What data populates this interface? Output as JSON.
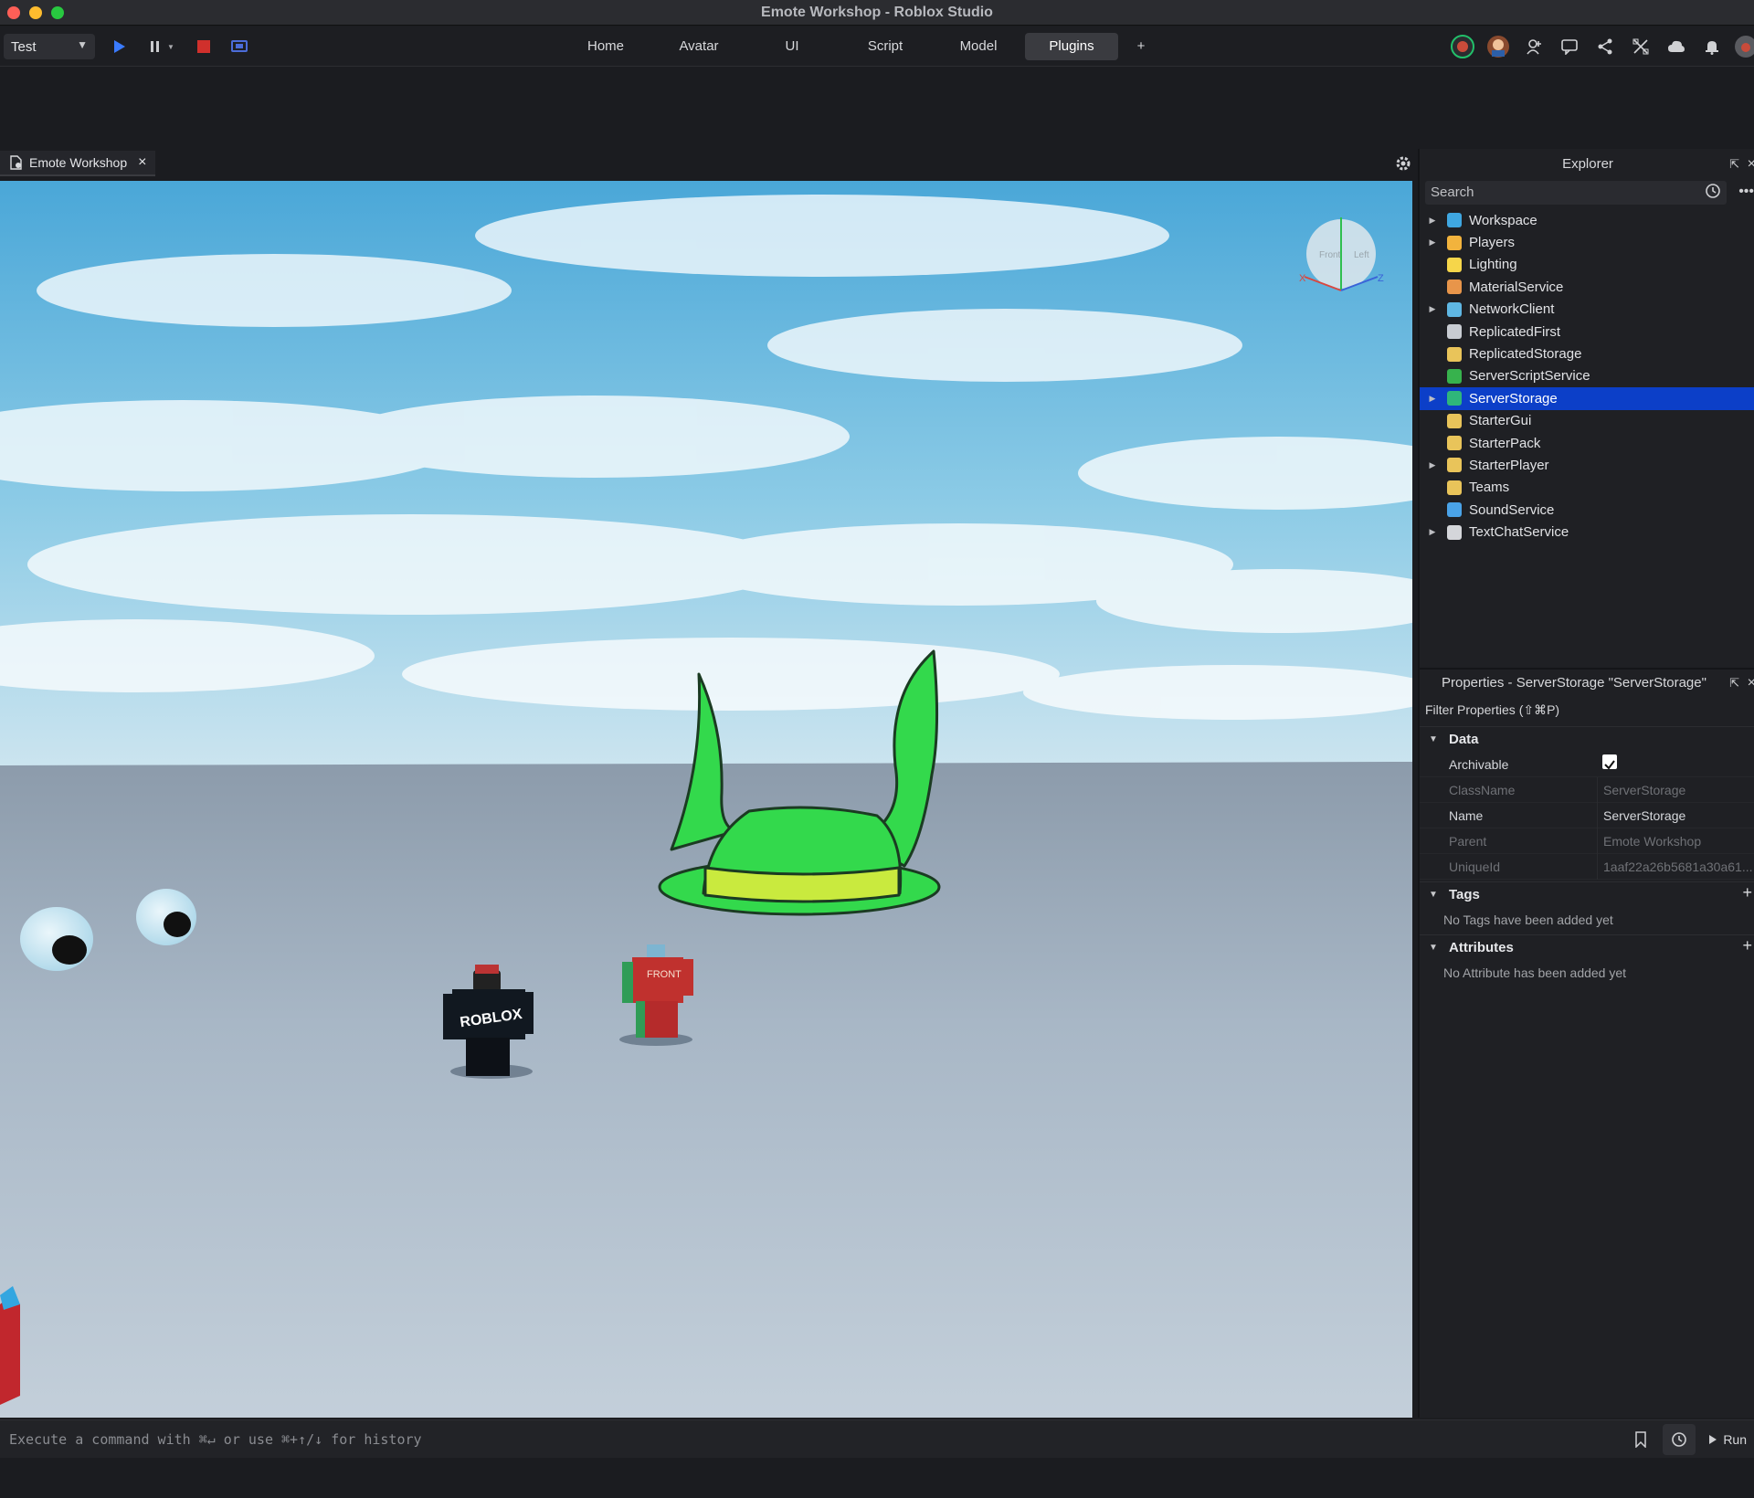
{
  "window": {
    "title": "Emote Workshop - Roblox Studio"
  },
  "toolbar": {
    "mode": "Test",
    "tabs": [
      {
        "label": "Home"
      },
      {
        "label": "Avatar"
      },
      {
        "label": "UI"
      },
      {
        "label": "Script"
      },
      {
        "label": "Model"
      },
      {
        "label": "Plugins",
        "active": true
      },
      {
        "label": "+"
      }
    ]
  },
  "document_tab": {
    "label": "Emote Workshop"
  },
  "viewport": {
    "gizmo_labels": {
      "front": "Front",
      "left": "Left",
      "x": "X",
      "z": "Z"
    },
    "characters": [
      {
        "name": "black-avatar",
        "shirt_text": "ROBLOX"
      },
      {
        "name": "red-avatar",
        "shirt_text": "FRONT"
      }
    ]
  },
  "explorer": {
    "title": "Explorer",
    "search_placeholder": "Search",
    "items": [
      {
        "label": "Workspace",
        "expandable": true,
        "icon": "workspace-icon",
        "color": "#3fa7e1"
      },
      {
        "label": "Players",
        "expandable": true,
        "icon": "players-icon",
        "color": "#f2b33d"
      },
      {
        "label": "Lighting",
        "expandable": false,
        "icon": "lightbulb-icon",
        "color": "#f6d64a"
      },
      {
        "label": "MaterialService",
        "expandable": false,
        "icon": "material-icon",
        "color": "#e8954a"
      },
      {
        "label": "NetworkClient",
        "expandable": true,
        "icon": "network-icon",
        "color": "#5fb7e3"
      },
      {
        "label": "ReplicatedFirst",
        "expandable": false,
        "icon": "replicated-first-icon",
        "color": "#c8ccd2"
      },
      {
        "label": "ReplicatedStorage",
        "expandable": false,
        "icon": "folder-icon",
        "color": "#e9c45a"
      },
      {
        "label": "ServerScriptService",
        "expandable": false,
        "icon": "server-script-icon",
        "color": "#37b24d"
      },
      {
        "label": "ServerStorage",
        "expandable": true,
        "icon": "server-storage-icon",
        "color": "#2fb67a",
        "selected": true
      },
      {
        "label": "StarterGui",
        "expandable": false,
        "icon": "folder-icon",
        "color": "#e9c45a"
      },
      {
        "label": "StarterPack",
        "expandable": false,
        "icon": "folder-icon",
        "color": "#e9c45a"
      },
      {
        "label": "StarterPlayer",
        "expandable": true,
        "icon": "folder-icon",
        "color": "#e9c45a"
      },
      {
        "label": "Teams",
        "expandable": false,
        "icon": "teams-icon",
        "color": "#e9c45a"
      },
      {
        "label": "SoundService",
        "expandable": false,
        "icon": "sound-icon",
        "color": "#4aa3e8"
      },
      {
        "label": "TextChatService",
        "expandable": true,
        "icon": "chat-icon",
        "color": "#d4d6da"
      }
    ]
  },
  "properties": {
    "title": "Properties - ServerStorage \"ServerStorage\"",
    "filter_placeholder": "Filter Properties (⇧⌘P)",
    "sections": {
      "data": "Data",
      "tags": "Tags",
      "attributes": "Attributes"
    },
    "rows": [
      {
        "name": "Archivable",
        "value": "",
        "checkbox": true,
        "dim": false
      },
      {
        "name": "ClassName",
        "value": "ServerStorage",
        "dim": true
      },
      {
        "name": "Name",
        "value": "ServerStorage",
        "dim": false
      },
      {
        "name": "Parent",
        "value": "Emote Workshop",
        "dim": true
      },
      {
        "name": "UniqueId",
        "value": "1aaf22a26b5681a30a61...",
        "dim": true
      }
    ],
    "tags_empty": "No Tags have been added yet",
    "attributes_empty": "No Attribute has been added yet"
  },
  "command_bar": {
    "placeholder": "Execute a command with ⌘↵ or use ⌘+↑/↓ for history",
    "run_label": "Run"
  }
}
